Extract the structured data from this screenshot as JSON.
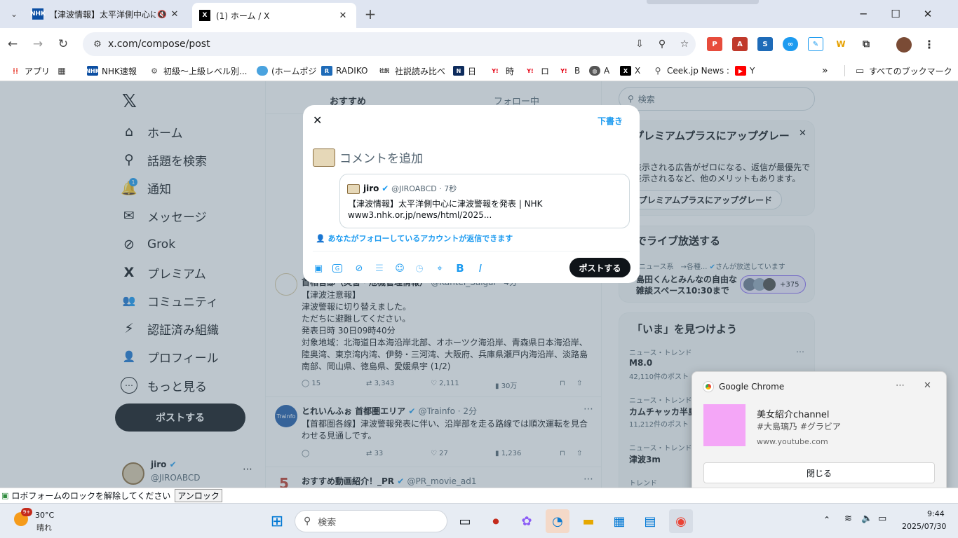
{
  "browser": {
    "tabs": [
      {
        "label": "【津波情報】太平洋側中心に津",
        "favicon": "NHK"
      },
      {
        "label": "(1) ホーム / X",
        "favicon": "X"
      }
    ],
    "new_tab": "+",
    "url": "x.com/compose/post",
    "bookmarks": [
      {
        "label": "アプリ",
        "icon": "apps-icon"
      },
      {
        "label": "",
        "icon": "grid-icon"
      },
      {
        "label": "NHK速報",
        "icon": "NHK"
      },
      {
        "label": "初級～上級レベル別...",
        "icon": "link-icon"
      },
      {
        "label": "(ホームポジ",
        "icon": "cloud-icon"
      },
      {
        "label": "RADIKO",
        "icon": "radio-icon"
      },
      {
        "label": "社説読み比べ",
        "icon": "社説"
      },
      {
        "label": "日",
        "icon": "nikkei-icon"
      },
      {
        "label": "時",
        "icon": "Y!"
      },
      {
        "label": "ロ",
        "icon": "Y!"
      },
      {
        "label": "B",
        "icon": "Y!"
      },
      {
        "label": "A",
        "icon": "globe-icon"
      },
      {
        "label": "X",
        "icon": "X"
      },
      {
        "label": "Ceek.jp News :",
        "icon": "search-icon"
      },
      {
        "label": "Y",
        "icon": "youtube-icon"
      }
    ],
    "all_bookmarks": "すべてのブックマーク"
  },
  "sidebar": {
    "items": [
      {
        "label": "ホーム",
        "icon": "⌂"
      },
      {
        "label": "話題を検索",
        "icon": "⚲"
      },
      {
        "label": "通知",
        "icon": "🔔",
        "badge": "1"
      },
      {
        "label": "メッセージ",
        "icon": "✉"
      },
      {
        "label": "Grok",
        "icon": "⊘"
      },
      {
        "label": "プレミアム",
        "icon": "X"
      },
      {
        "label": "コミュニティ",
        "icon": "👥"
      },
      {
        "label": "認証済み組織",
        "icon": "⚡"
      },
      {
        "label": "プロフィール",
        "icon": "👤"
      },
      {
        "label": "もっと見る",
        "icon": "⋯"
      }
    ],
    "post_button": "ポストする",
    "account_name": "jiro",
    "account_handle": "@JIROABCD"
  },
  "timeline": {
    "tabs": [
      "おすすめ",
      "フォロー中"
    ],
    "tweets": [
      {
        "author": "首相官邸（災害・危機管理情報）",
        "handle": "@Kantei_Saigai · 4分",
        "lines": [
          "【津波注意報】",
          "津波警報に切り替えました。",
          "ただちに避難してください。",
          "発表日時 30日09時40分",
          "対象地域：北海道日本海沿岸北部、オホーツク海沿岸、青森県日本海沿岸、",
          "陸奥湾、東京湾内湾、伊勢・三河湾、大阪府、兵庫県瀬戸内海沿岸、淡路島",
          "南部、岡山県、徳島県、愛媛県宇 (1/2)"
        ],
        "replies": "15",
        "reposts": "3,343",
        "likes": "2,111",
        "views": "30万"
      },
      {
        "author": "とれいんふぉ 首都圏エリア",
        "handle": "@Trainfo · 2分",
        "lines": [
          "【首都圏各線】津波警報発表に伴い、沿岸部を走る路線では順次運転を見合",
          "わせる見通しです。"
        ],
        "replies": "",
        "reposts": "33",
        "likes": "27",
        "views": "1,236"
      },
      {
        "author": "おすすめ動画紹介！_PR",
        "handle": "@PR_movie_ad1",
        "lines": []
      }
    ]
  },
  "right_column": {
    "search_placeholder": "検索",
    "premium_title": "プレミアムプラスにアップグレー",
    "premium_body": [
      "表示される広告がゼロになる、返信が最優先で",
      "表示されるなど、他のメリットもあります。"
    ],
    "premium_button": "プレミアムプラスにアップグレード",
    "live_title": "でライブ放送する",
    "live_host": "系ニュース系　→各種...",
    "live_host_suffix": "さんが放送しています",
    "live_desc": [
      "島田くんとみんなの自由な",
      "雑談スペース10:30まで"
    ],
    "live_count": "+375",
    "explore_title": "「いま」を見つけよう",
    "trends": [
      {
        "meta": "ニュース・トレンド",
        "title": "M8.0",
        "count": "42,110件のポスト"
      },
      {
        "meta": "ニュース・トレンド",
        "title": "カムチャッカ半島",
        "count": "11,212件のポスト"
      },
      {
        "meta": "ニュース・トレンド",
        "title": "津波3m",
        "count": ""
      },
      {
        "meta": "トレンド",
        "title": "",
        "count": ""
      }
    ]
  },
  "compose": {
    "drafts": "下書き",
    "placeholder": "コメントを追加",
    "quoted_name": "jiro",
    "quoted_handle": "@JIROABCD · 7秒",
    "quoted_text": "【津波情報】太平洋側中心に津波警報を発表 | NHK",
    "quoted_link": "www3.nhk.or.jp/news/html/2025...",
    "reply_setting": "あなたがフォローしているアカウントが返信できます",
    "post_button": "ポストする"
  },
  "notification": {
    "app": "Google Chrome",
    "title": "美女紹介channel",
    "subtitle": "#大島璃乃 #グラビア",
    "source": "www.youtube.com",
    "close_button": "閉じる"
  },
  "popup_bar": {
    "message": "ロボフォームのロックを解除してください",
    "button": "アンロック"
  },
  "taskbar": {
    "weather_temp": "30°C",
    "weather_desc": "晴れ",
    "weather_badge": "9+",
    "search_placeholder": "検索",
    "time": "9:44",
    "date": "2025/07/30"
  },
  "colors": {
    "accent": "#1d9bf0",
    "dark": "#0f1419",
    "overlay": "#5b7083"
  }
}
